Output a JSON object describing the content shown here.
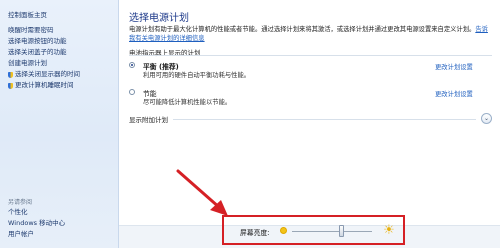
{
  "sidebar": {
    "home": "控制面板主页",
    "links": [
      {
        "label": "唤醒时需要密码",
        "icon": ""
      },
      {
        "label": "选择电源按钮的功能",
        "icon": ""
      },
      {
        "label": "选择关闭盖子的功能",
        "icon": ""
      },
      {
        "label": "创建电源计划",
        "icon": ""
      },
      {
        "label": "选择关闭显示器的时间",
        "icon": "shield-icon"
      },
      {
        "label": "更改计算机睡眠时间",
        "icon": "shield-icon"
      }
    ],
    "see_also": "另请参阅",
    "bottom_links": [
      {
        "label": "个性化"
      },
      {
        "label": "Windows 移动中心"
      },
      {
        "label": "用户帐户"
      }
    ]
  },
  "main": {
    "title": "选择电源计划",
    "desc_text": "电源计划有助于最大化计算机的性能或者节能。通过选择计划来将其激活，或选择计划并通过更改其电源设置来自定义计划。",
    "desc_link": "告诉我有关电源计划的详细信息",
    "section_head": "电池指示器上显示的计划",
    "plans": [
      {
        "name": "平衡 (推荐)",
        "desc": "利用可用的硬件自动平衡功耗与性能。",
        "link": "更改计划设置"
      },
      {
        "name": "节能",
        "desc": "尽可能降低计算机性能以节能。",
        "link": "更改计划设置"
      }
    ],
    "more_label": "显示附加计划"
  },
  "brightness": {
    "label": "屏幕亮度:",
    "level": 0.62
  },
  "colors": {
    "highlight": "#d52025",
    "link": "#1f5fbf",
    "title": "#1e3a8a"
  }
}
